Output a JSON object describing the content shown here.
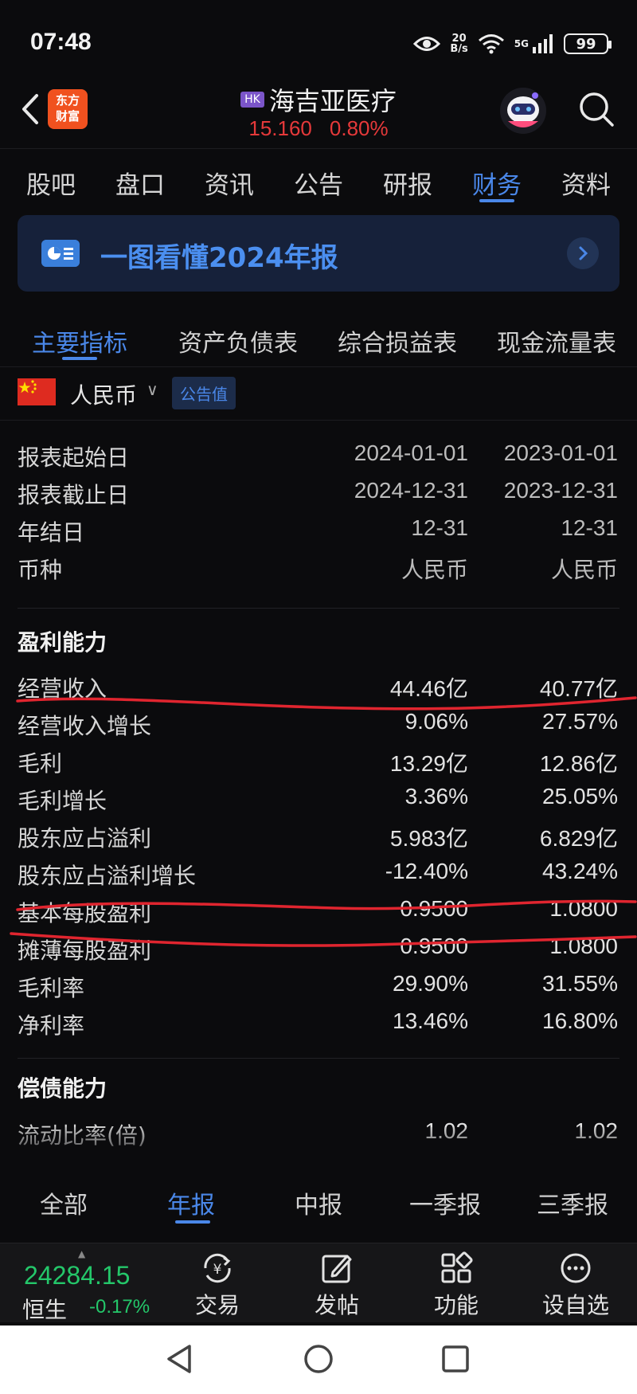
{
  "status_bar": {
    "time": "07:48",
    "net_speed_value": "20",
    "net_speed_unit": "B/s",
    "network": "5G",
    "battery": "99"
  },
  "header": {
    "market_badge": "HK",
    "stock_name": "海吉亚医疗",
    "price": "15.160",
    "change_pct": "0.80%",
    "logo_line1": "东方",
    "logo_line2": "财富",
    "price_color": "#e5393a"
  },
  "top_tabs": [
    {
      "label": "股吧",
      "active": false
    },
    {
      "label": "盘口",
      "active": false
    },
    {
      "label": "资讯",
      "active": false
    },
    {
      "label": "公告",
      "active": false
    },
    {
      "label": "研报",
      "active": false
    },
    {
      "label": "财务",
      "active": true
    },
    {
      "label": "资料",
      "active": false
    }
  ],
  "banner": {
    "text": "一图看懂2024年报",
    "icon": "report-chart-icon"
  },
  "sub_tabs": [
    {
      "label": "主要指标",
      "active": true
    },
    {
      "label": "资产负债表",
      "active": false
    },
    {
      "label": "综合损益表",
      "active": false
    },
    {
      "label": "现金流量表",
      "active": false
    }
  ],
  "currency": {
    "label": "人民币",
    "badge": "公告值",
    "flag": "china-flag-icon"
  },
  "table": {
    "meta_rows": [
      {
        "label": "报表起始日",
        "v1": "2024-01-01",
        "v2": "2023-01-01"
      },
      {
        "label": "报表截止日",
        "v1": "2024-12-31",
        "v2": "2023-12-31"
      },
      {
        "label": "年结日",
        "v1": "12-31",
        "v2": "12-31"
      },
      {
        "label": "币种",
        "v1": "人民币",
        "v2": "人民币"
      }
    ],
    "section_profit": "盈利能力",
    "profit_rows": [
      {
        "label": "经营收入",
        "v1": "44.46亿",
        "v2": "40.77亿"
      },
      {
        "label": "经营收入增长",
        "v1": "9.06%",
        "v2": "27.57%"
      },
      {
        "label": "毛利",
        "v1": "13.29亿",
        "v2": "12.86亿"
      },
      {
        "label": "毛利增长",
        "v1": "3.36%",
        "v2": "25.05%"
      },
      {
        "label": "股东应占溢利",
        "v1": "5.983亿",
        "v2": "6.829亿"
      },
      {
        "label": "股东应占溢利增长",
        "v1": "-12.40%",
        "v2": "43.24%"
      },
      {
        "label": "基本每股盈利",
        "v1": "0.9500",
        "v2": "1.0800"
      },
      {
        "label": "摊薄每股盈利",
        "v1": "0.9500",
        "v2": "1.0800"
      },
      {
        "label": "毛利率",
        "v1": "29.90%",
        "v2": "31.55%"
      },
      {
        "label": "净利率",
        "v1": "13.46%",
        "v2": "16.80%"
      }
    ],
    "section_solvency": "偿债能力",
    "solvency_rows": [
      {
        "label": "流动比率(倍)",
        "v1": "1.02",
        "v2": "1.02"
      }
    ],
    "annotation_color": "#e0252f"
  },
  "period_tabs": [
    {
      "label": "全部",
      "active": false
    },
    {
      "label": "年报",
      "active": true
    },
    {
      "label": "中报",
      "active": false
    },
    {
      "label": "一季报",
      "active": false
    },
    {
      "label": "三季报",
      "active": false
    }
  ],
  "bottom_bar": {
    "index_value": "24284.15",
    "index_name": "恒生",
    "index_change": "-0.17%",
    "index_color": "#24c76a",
    "buttons": [
      {
        "label": "交易",
        "icon": "yen-exchange-icon"
      },
      {
        "label": "发帖",
        "icon": "edit-post-icon"
      },
      {
        "label": "功能",
        "icon": "grid-apps-icon"
      },
      {
        "label": "设自选",
        "icon": "more-dots-icon"
      }
    ]
  },
  "accent_color": "#4a87e8"
}
